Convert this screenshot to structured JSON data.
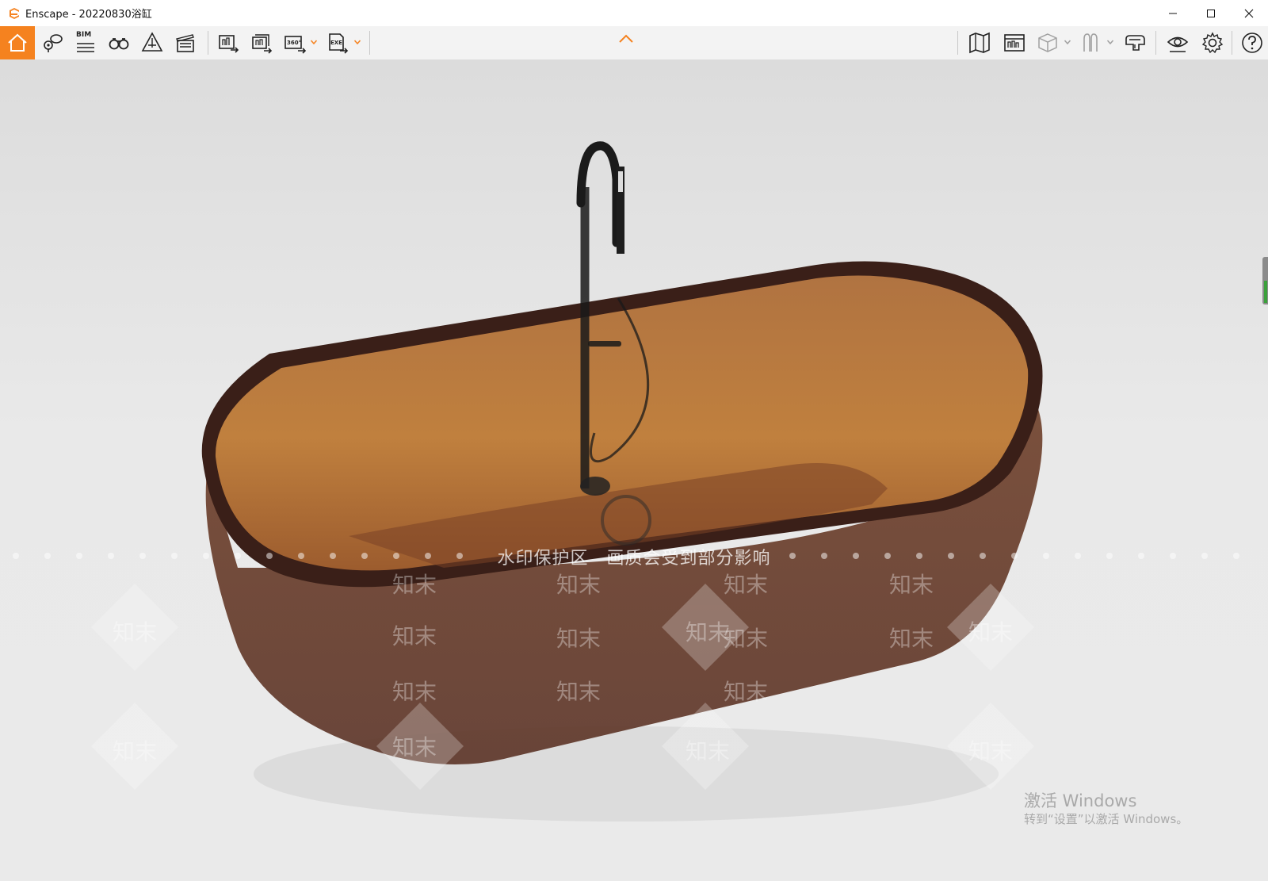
{
  "window": {
    "title": "Enscape - 20220830浴缸",
    "controls": [
      "minimize",
      "maximize",
      "close"
    ]
  },
  "toolbar": {
    "left_buttons": [
      {
        "name": "home",
        "icon": "home-icon",
        "active": true
      },
      {
        "name": "views",
        "icon": "map-pin-icon"
      },
      {
        "name": "bim",
        "icon": "bim-icon",
        "label": "BIM"
      },
      {
        "name": "walk-mode",
        "icon": "binoculars-icon"
      },
      {
        "name": "navigation",
        "icon": "compass-icon"
      },
      {
        "name": "video-editor",
        "icon": "clapperboard-icon"
      },
      {
        "name": "render-image",
        "icon": "render-image-icon"
      },
      {
        "name": "batch-render",
        "icon": "batch-render-icon"
      },
      {
        "name": "panorama",
        "icon": "panorama-360-icon",
        "label": "360°"
      },
      {
        "name": "export-exe",
        "icon": "export-exe-icon",
        "label": "EXE"
      }
    ],
    "right_buttons": [
      {
        "name": "minimap",
        "icon": "map-icon"
      },
      {
        "name": "asset-library",
        "icon": "asset-library-icon"
      },
      {
        "name": "material-editor",
        "icon": "cube-icon"
      },
      {
        "name": "vr-headset",
        "icon": "headset-icon"
      },
      {
        "name": "camera",
        "icon": "camera-icon"
      },
      {
        "name": "visual-settings",
        "icon": "eye-icon"
      },
      {
        "name": "settings",
        "icon": "gear-icon"
      },
      {
        "name": "help",
        "icon": "help-icon"
      }
    ],
    "collapse_icon": "chevron-up-icon",
    "accent_color": "#f5821f"
  },
  "viewport": {
    "watermark_banner": "水印保护区　画质会受到部分影响",
    "watermark_text": "知末",
    "activation": {
      "title": "激活 Windows",
      "subtitle": "转到“设置”以激活 Windows。"
    }
  }
}
